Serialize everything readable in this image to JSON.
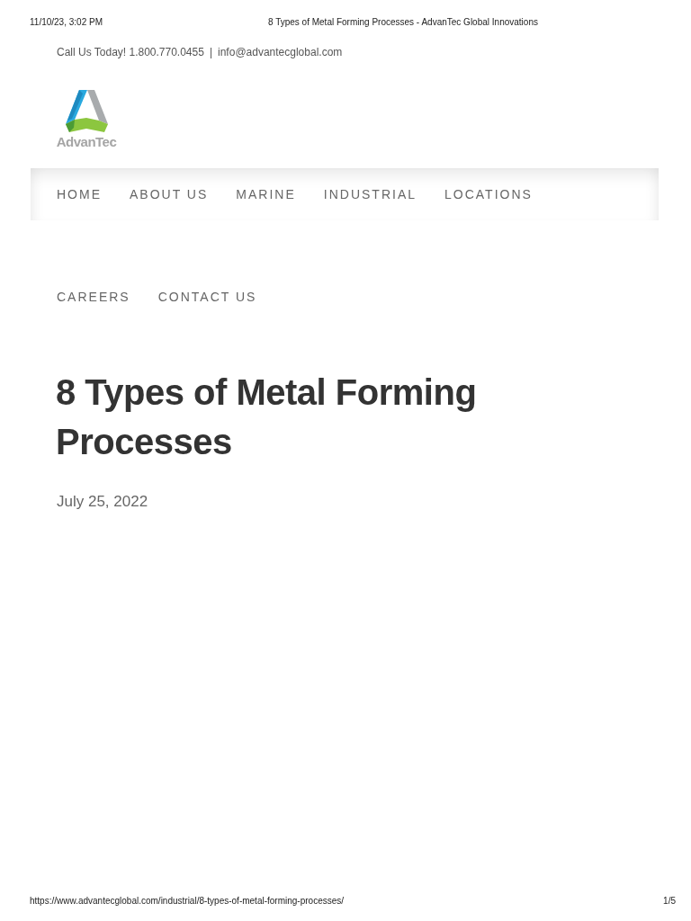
{
  "print_header": {
    "date": "11/10/23, 3:02 PM",
    "title": "8 Types of Metal Forming Processes - AdvanTec Global Innovations"
  },
  "top_bar": {
    "phone": "Call Us Today! 1.800.770.0455",
    "separator": "|",
    "email": "info@advantecglobal.com"
  },
  "logo": {
    "text": "AdvanTec"
  },
  "nav_rows": [
    {
      "items": [
        {
          "label": "HOME"
        },
        {
          "label": "ABOUT US"
        },
        {
          "label": "MARINE"
        },
        {
          "label": "INDUSTRIAL"
        },
        {
          "label": "LOCATIONS"
        }
      ]
    },
    {
      "items": [
        {
          "label": "CAREERS"
        },
        {
          "label": "CONTACT US"
        }
      ]
    }
  ],
  "article": {
    "title": "8 Types of Metal Forming Processes",
    "date": "July 25, 2022"
  },
  "print_footer": {
    "url": "https://www.advantecglobal.com/industrial/8-types-of-metal-forming-processes/",
    "page": "1/5"
  }
}
